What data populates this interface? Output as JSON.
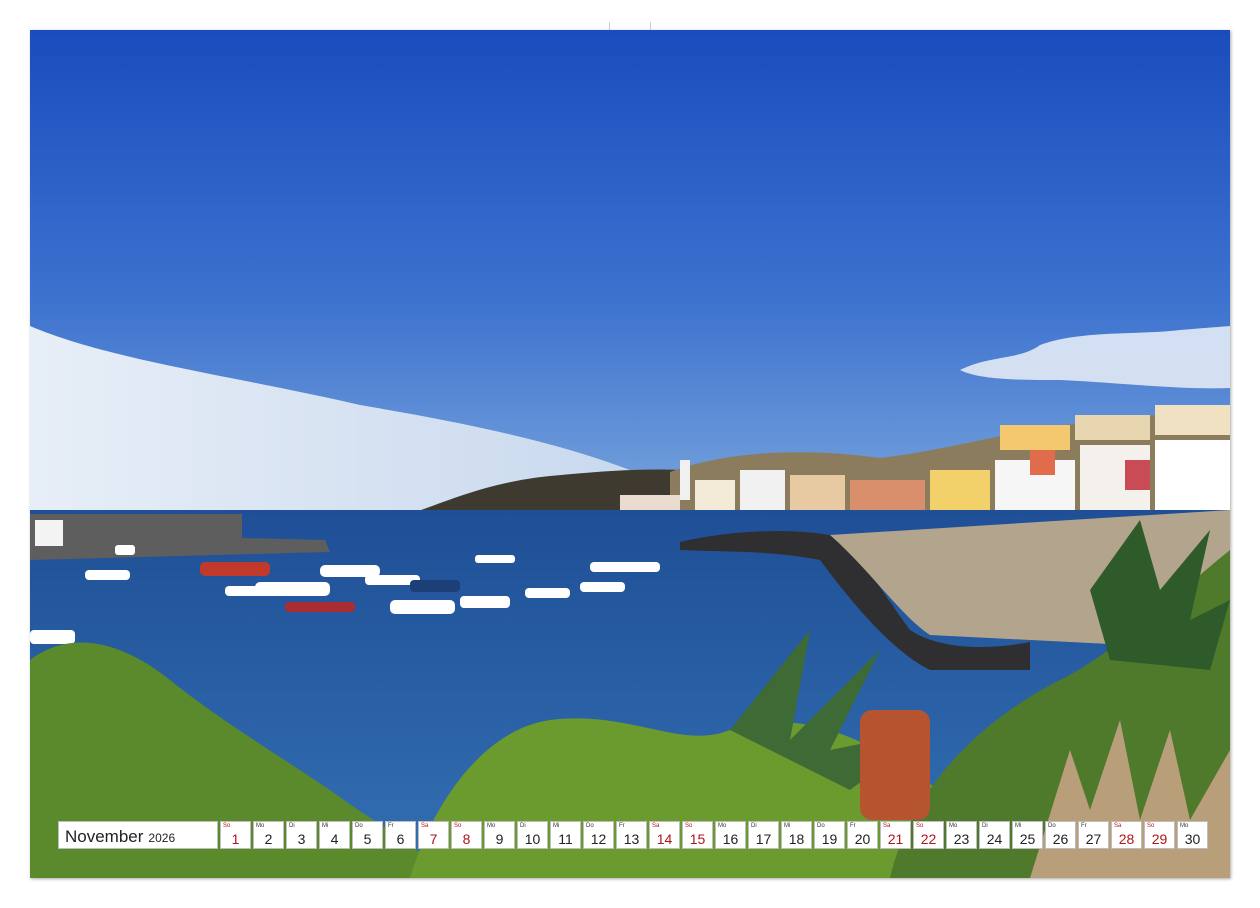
{
  "calendar": {
    "month": "November",
    "year": "2026",
    "days": [
      {
        "wd": "So",
        "num": "1",
        "weekend": true
      },
      {
        "wd": "Mo",
        "num": "2",
        "weekend": false
      },
      {
        "wd": "Di",
        "num": "3",
        "weekend": false
      },
      {
        "wd": "Mi",
        "num": "4",
        "weekend": false
      },
      {
        "wd": "Do",
        "num": "5",
        "weekend": false
      },
      {
        "wd": "Fr",
        "num": "6",
        "weekend": false
      },
      {
        "wd": "Sa",
        "num": "7",
        "weekend": true
      },
      {
        "wd": "So",
        "num": "8",
        "weekend": true
      },
      {
        "wd": "Mo",
        "num": "9",
        "weekend": false
      },
      {
        "wd": "Di",
        "num": "10",
        "weekend": false
      },
      {
        "wd": "Mi",
        "num": "11",
        "weekend": false
      },
      {
        "wd": "Do",
        "num": "12",
        "weekend": false
      },
      {
        "wd": "Fr",
        "num": "13",
        "weekend": false
      },
      {
        "wd": "Sa",
        "num": "14",
        "weekend": true
      },
      {
        "wd": "So",
        "num": "15",
        "weekend": true
      },
      {
        "wd": "Mo",
        "num": "16",
        "weekend": false
      },
      {
        "wd": "Di",
        "num": "17",
        "weekend": false
      },
      {
        "wd": "Mi",
        "num": "18",
        "weekend": false
      },
      {
        "wd": "Do",
        "num": "19",
        "weekend": false
      },
      {
        "wd": "Fr",
        "num": "20",
        "weekend": false
      },
      {
        "wd": "Sa",
        "num": "21",
        "weekend": true
      },
      {
        "wd": "So",
        "num": "22",
        "weekend": true
      },
      {
        "wd": "Mo",
        "num": "23",
        "weekend": false
      },
      {
        "wd": "Di",
        "num": "24",
        "weekend": false
      },
      {
        "wd": "Mi",
        "num": "25",
        "weekend": false
      },
      {
        "wd": "Do",
        "num": "26",
        "weekend": false
      },
      {
        "wd": "Fr",
        "num": "27",
        "weekend": false
      },
      {
        "wd": "Sa",
        "num": "28",
        "weekend": true
      },
      {
        "wd": "So",
        "num": "29",
        "weekend": true
      },
      {
        "wd": "Mo",
        "num": "30",
        "weekend": false
      }
    ]
  },
  "colors": {
    "sky_top": "#1b4fc0",
    "sky_bottom": "#6f9cd8",
    "sea": "#2b62a8",
    "weekend_text": "#b0141c"
  }
}
